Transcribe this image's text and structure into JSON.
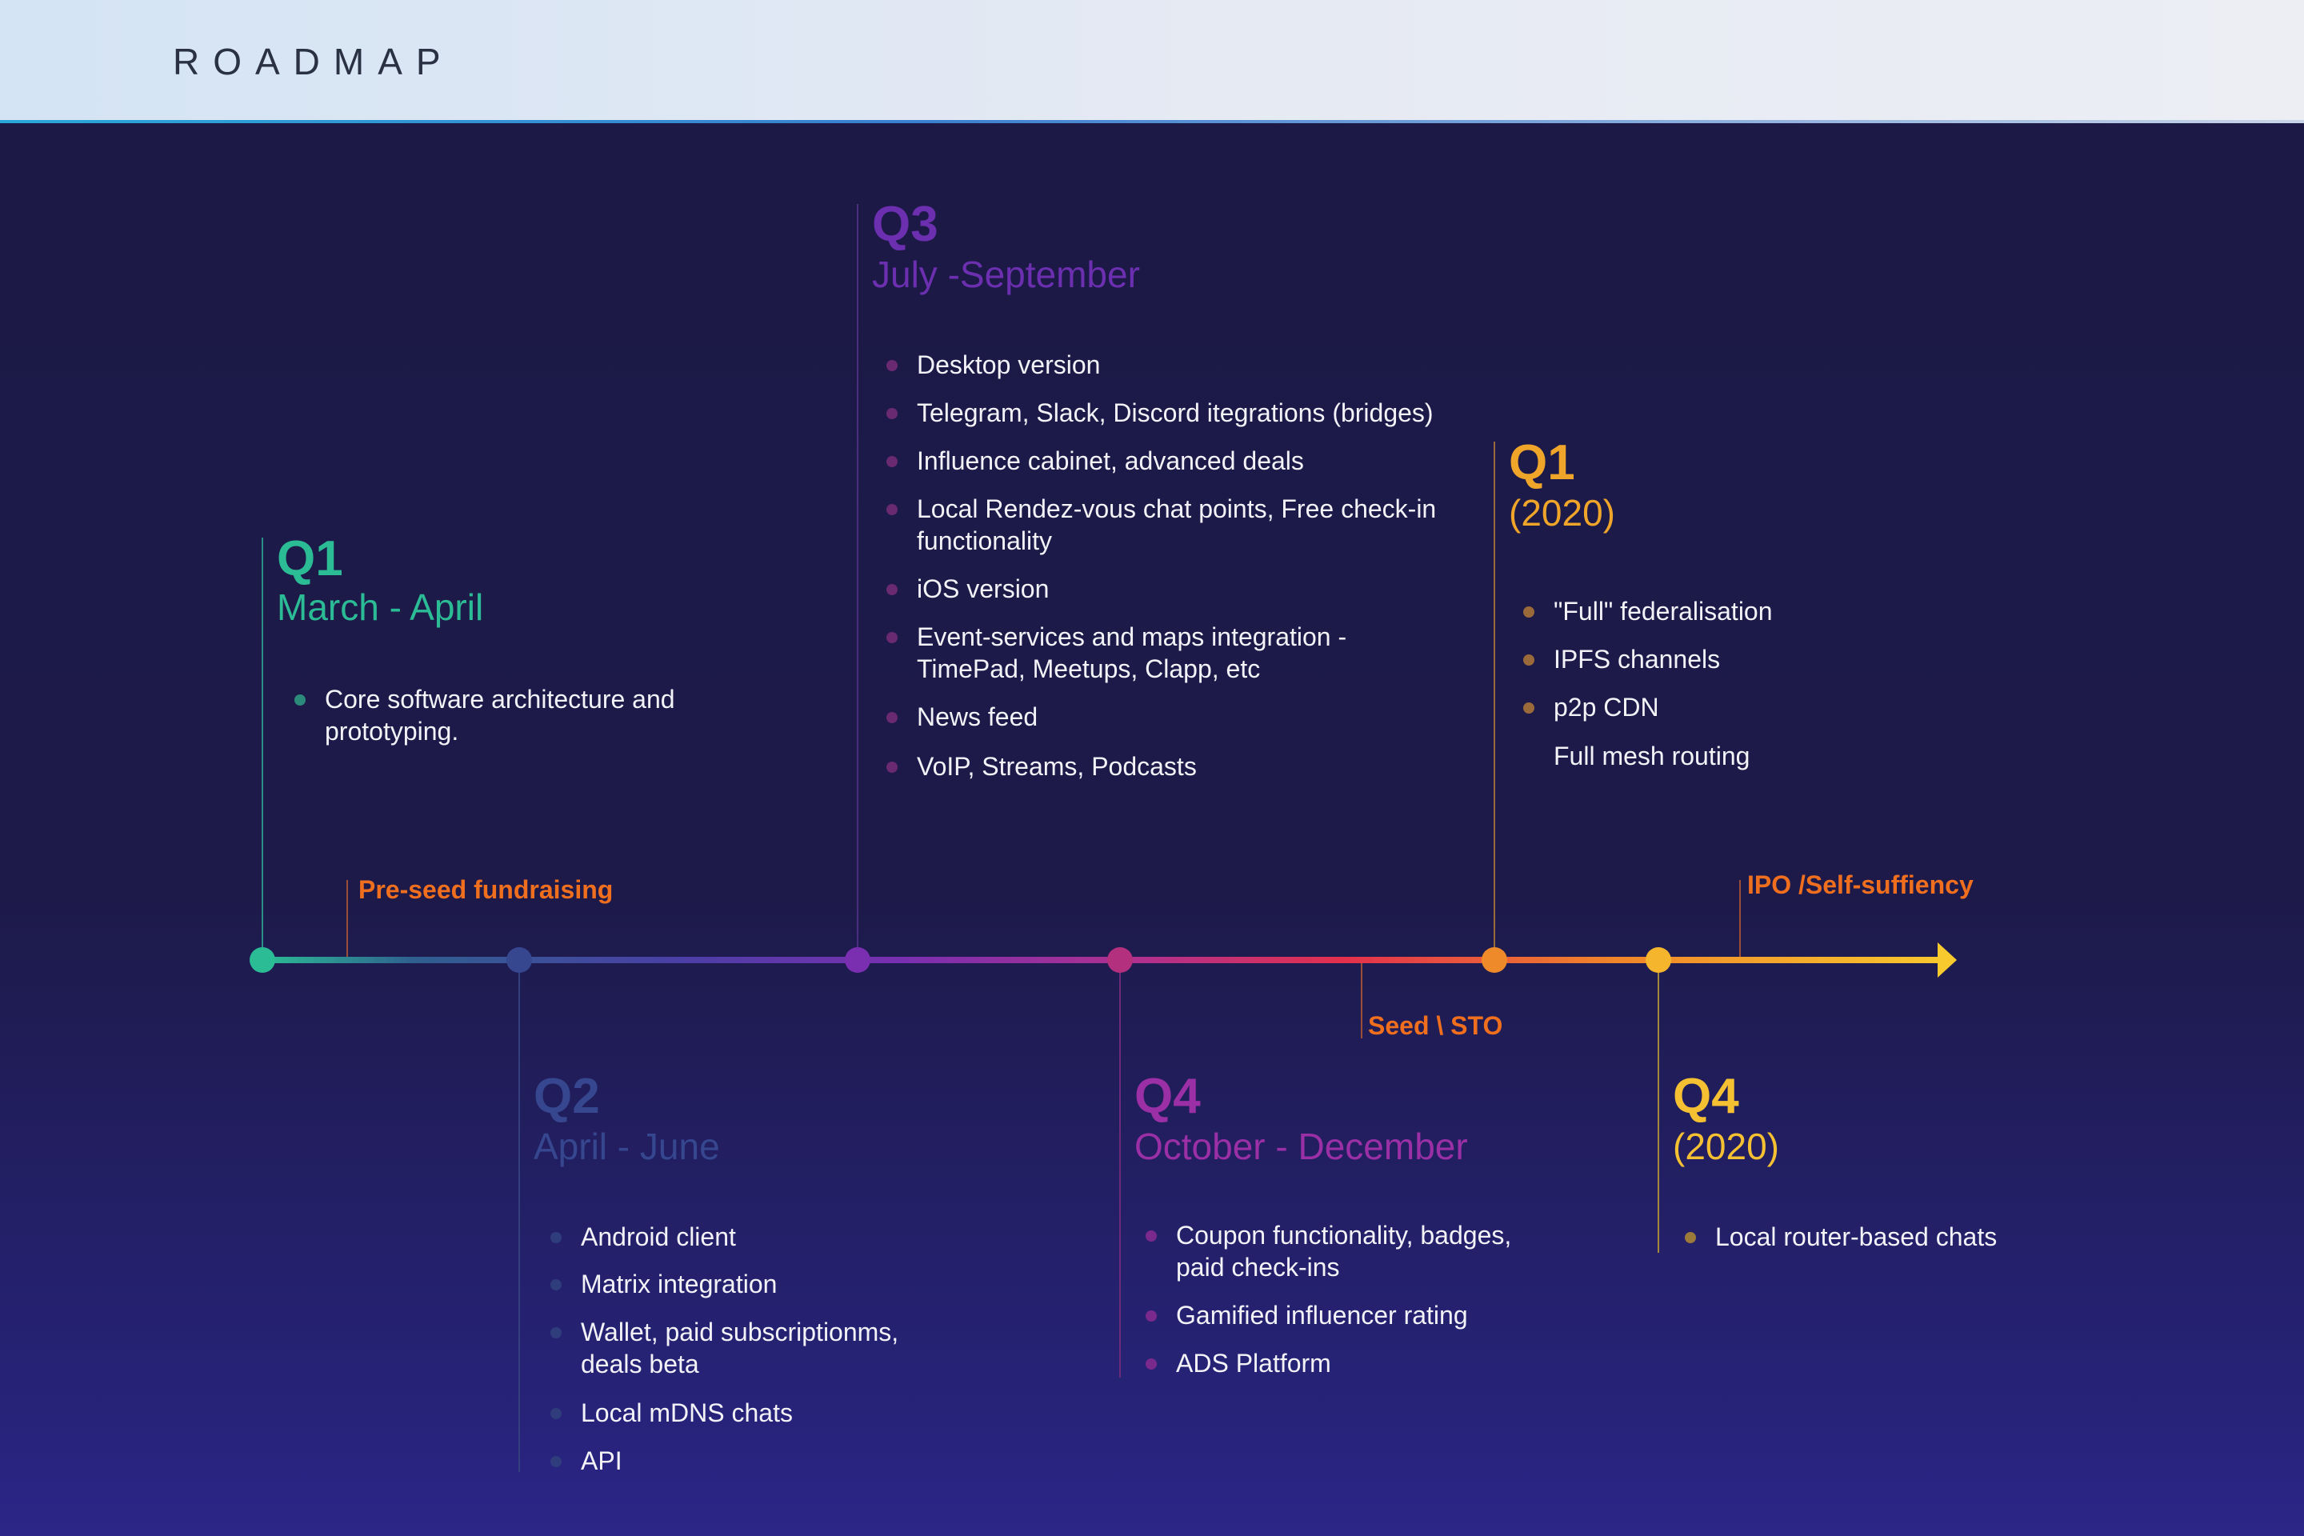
{
  "header": {
    "title": "ROADMAP"
  },
  "colors": {
    "q1": "#2bbc95",
    "q2": "#36478f",
    "q3": "#6b2fb0",
    "q4": "#9a2fa6",
    "q1_2020": "#efa52a",
    "q4_2020": "#f5c133",
    "milestone": "#ef6f1e"
  },
  "quarters": [
    {
      "label": "Q1",
      "period": "March - April",
      "items": [
        "Core software architecture and\nprototyping."
      ]
    },
    {
      "label": "Q2",
      "period": "April - June",
      "items": [
        "Android client",
        "Matrix integration",
        "Wallet, paid subscriptionms,\ndeals beta",
        "Local mDNS chats",
        "API"
      ]
    },
    {
      "label": "Q3",
      "period": "July -September",
      "items": [
        "Desktop version",
        "Telegram, Slack, Discord itegrations (bridges)",
        "Influence cabinet, advanced deals",
        "Local Rendez-vous chat points, Free check-in\nfunctionality",
        "iOS version",
        "Event-services and maps integration -\nTimePad, Meetups, Clapp, etc",
        "News feed",
        "VoIP, Streams, Podcasts"
      ]
    },
    {
      "label": "Q4",
      "period": "October - December",
      "items": [
        "Coupon functionality, badges,\npaid check-ins",
        "Gamified influencer rating",
        "ADS Platform"
      ]
    },
    {
      "label": "Q1",
      "period": "(2020)",
      "items": [
        "\"Full\" federalisation",
        "IPFS channels",
        "p2p CDN"
      ],
      "extra_item": "Full mesh routing"
    },
    {
      "label": "Q4",
      "period": "(2020)",
      "items": [
        "Local router-based chats"
      ]
    }
  ],
  "milestones": [
    "Pre-seed fundraising",
    "Seed \\ STO",
    "IPO /Self-suffiency"
  ]
}
